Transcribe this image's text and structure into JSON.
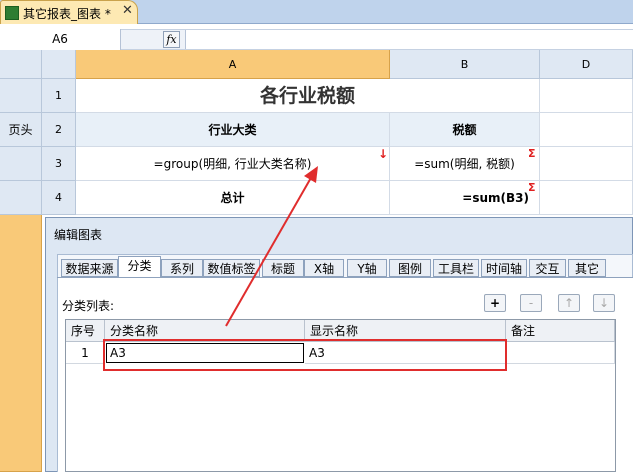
{
  "tab": {
    "title": "其它报表_图表 *",
    "close": "✕"
  },
  "formula_bar": {
    "cell_ref": "A6",
    "fx": "fx",
    "value": ""
  },
  "columns": [
    "A",
    "B",
    "D"
  ],
  "rows": [
    "1",
    "2",
    "3",
    "4"
  ],
  "zone_labels": {
    "header": "页头"
  },
  "cells": {
    "title": "各行业税额",
    "col_industry": "行业大类",
    "col_tax": "税额",
    "group_formula": "=group(明细, 行业大类名称)",
    "sum_formula": "=sum(明细, 税额)",
    "total_label": "总计",
    "total_formula": "=sum(B3)",
    "sigma": "Σ",
    "expand_arrow": "↓"
  },
  "dialog": {
    "title": "编辑图表",
    "tabs": [
      "数据来源",
      "分类",
      "系列",
      "数值标签",
      "标题",
      "X轴",
      "Y轴",
      "图例",
      "工具栏",
      "时间轴",
      "交互",
      "其它"
    ],
    "active_tab": "分类",
    "list_label": "分类列表:",
    "toolbar": {
      "add": "+",
      "remove": "-",
      "up": "↑",
      "down": "↓"
    },
    "grid_headers": {
      "seq": "序号",
      "category_name": "分类名称",
      "display_name": "显示名称",
      "note": "备注"
    },
    "grid_rows": [
      {
        "seq": "1",
        "category_name": "A3",
        "display_name": "A3",
        "note": ""
      }
    ]
  },
  "colors": {
    "accent_red": "#e02d2d",
    "selected_col": "#f9c978",
    "header_bg": "#dfe8f3"
  }
}
